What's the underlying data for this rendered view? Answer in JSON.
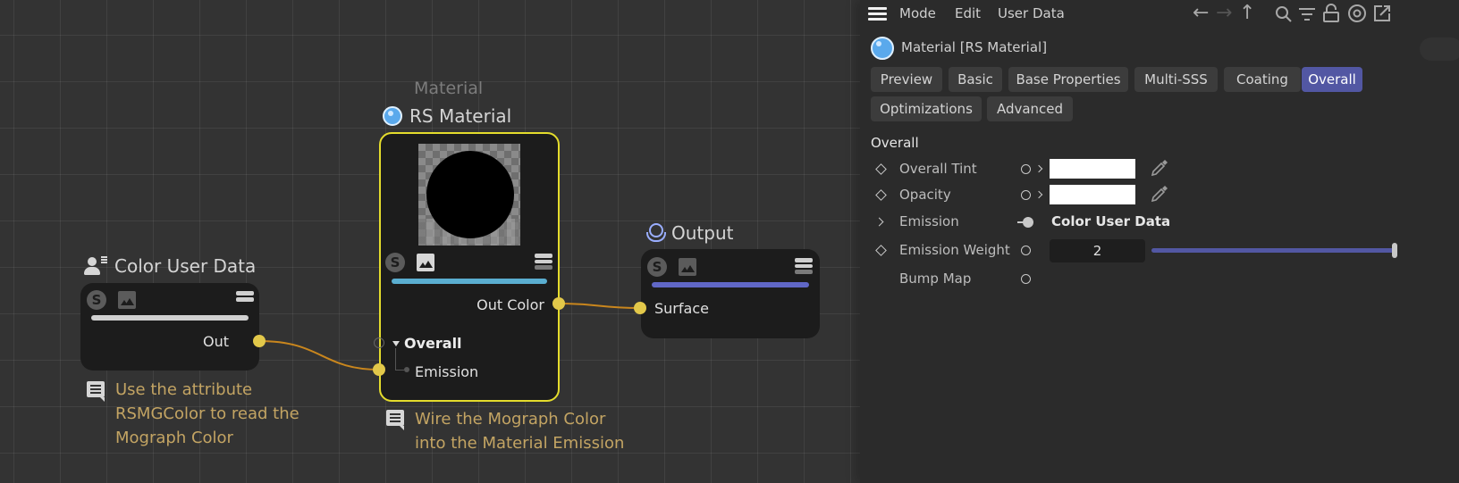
{
  "canvas": {
    "nodes": {
      "color_user_data": {
        "title": "Color User Data",
        "outputs": [
          "Out"
        ],
        "bar_color": "#d0d0d0"
      },
      "rs_material": {
        "subtitle": "Material",
        "title": "RS Material",
        "outputs": [
          "Out Color"
        ],
        "group": "Overall",
        "inputs": [
          "Emission"
        ],
        "bar_color": "#5aaed0",
        "selected": true
      },
      "output": {
        "title": "Output",
        "inputs": [
          "Surface"
        ],
        "bar_color": "#6067c6"
      }
    },
    "connections": [
      {
        "from": "Color User Data.Out",
        "to": "RS Material.Emission"
      },
      {
        "from": "RS Material.Out Color",
        "to": "Output.Surface"
      }
    ],
    "notes": [
      {
        "lines": [
          "Use the attribute",
          "RSMGColor to read the",
          "Mograph Color"
        ]
      },
      {
        "lines": [
          "Wire the Mograph Color",
          "into the Material Emission"
        ]
      }
    ],
    "colors": {
      "port": "#e2c84a",
      "wire": "#c9861d",
      "selection": "#e4dc2c",
      "note_text": "#c3a463"
    }
  },
  "panel": {
    "menu": [
      "Mode",
      "Edit",
      "User Data"
    ],
    "toolbar_icons": [
      "arrow-left-icon",
      "arrow-right-icon",
      "arrow-up-icon",
      "search-icon",
      "filter-icon",
      "lock-icon",
      "target-icon",
      "new-window-icon"
    ],
    "object_title": "Material [RS Material]",
    "tabs": [
      {
        "label": "Preview",
        "active": false
      },
      {
        "label": "Basic",
        "active": false
      },
      {
        "label": "Base Properties",
        "active": false
      },
      {
        "label": "Multi-SSS",
        "active": false
      },
      {
        "label": "Coating",
        "active": false
      },
      {
        "label": "Overall",
        "active": true
      },
      {
        "label": "Optimizations",
        "active": false
      },
      {
        "label": "Advanced",
        "active": false
      }
    ],
    "section_title": "Overall",
    "params": [
      {
        "label": "Overall Tint",
        "type": "color",
        "value": "#ffffff"
      },
      {
        "label": "Opacity",
        "type": "color",
        "value": "#ffffff"
      },
      {
        "label": "Emission",
        "type": "link",
        "value": "Color User Data"
      },
      {
        "label": "Emission Weight",
        "type": "slider",
        "value": "2",
        "slider_fraction": 1.0
      },
      {
        "label": "Bump Map",
        "type": "port",
        "value": ""
      }
    ],
    "accent": "#5257a3"
  }
}
